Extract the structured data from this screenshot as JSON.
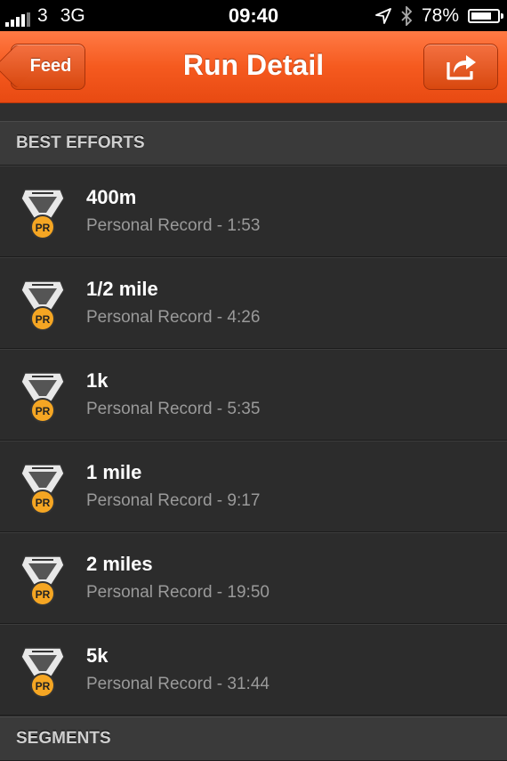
{
  "status_bar": {
    "carrier": "3",
    "network": "3G",
    "time": "09:40",
    "battery": "78%",
    "battery_level": 0.78
  },
  "nav": {
    "back_label": "Feed",
    "title": "Run Detail",
    "share_icon": "share-icon",
    "accent_color": "#f55a1f"
  },
  "sections": {
    "best_efforts": "BEST EFFORTS",
    "segments": "SEGMENTS"
  },
  "efforts": [
    {
      "name": "400m",
      "record": "Personal Record - 1:53",
      "badge": "PR"
    },
    {
      "name": "1/2 mile",
      "record": "Personal Record - 4:26",
      "badge": "PR"
    },
    {
      "name": "1k",
      "record": "Personal Record - 5:35",
      "badge": "PR"
    },
    {
      "name": "1 mile",
      "record": "Personal Record - 9:17",
      "badge": "PR"
    },
    {
      "name": "2 miles",
      "record": "Personal Record - 19:50",
      "badge": "PR"
    },
    {
      "name": "5k",
      "record": "Personal Record - 31:44",
      "badge": "PR"
    }
  ]
}
